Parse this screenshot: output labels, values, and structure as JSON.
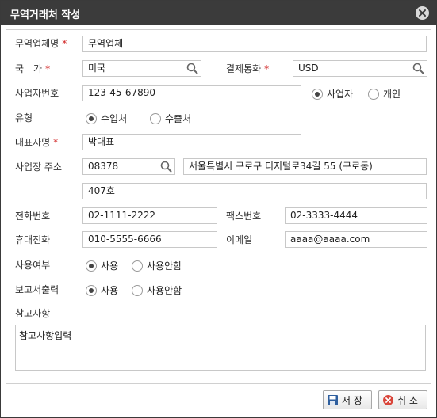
{
  "window": {
    "title": "무역거래처 작성"
  },
  "form": {
    "company_name": {
      "label": "무역업체명",
      "required": true,
      "value": "무역업체"
    },
    "country": {
      "label": "국　가",
      "required": true,
      "value": "미국"
    },
    "currency": {
      "label": "결제통화",
      "required": true,
      "value": "USD"
    },
    "business_no": {
      "label": "사업자번호",
      "value": "123-45-67890"
    },
    "entity_type": {
      "options": [
        "사업자",
        "개인"
      ],
      "selected": "사업자"
    },
    "trade_type": {
      "label": "유형",
      "options": [
        "수입처",
        "수출처"
      ],
      "selected": "수입처"
    },
    "ceo_name": {
      "label": "대표자명",
      "required": true,
      "value": "박대표"
    },
    "address": {
      "label": "사업장 주소",
      "zip": "08378",
      "street": "서울특별시 구로구 디지털로34길 55 (구로동)",
      "detail": "407호"
    },
    "phone": {
      "label": "전화번호",
      "value": "02-1111-2222"
    },
    "fax": {
      "label": "팩스번호",
      "value": "02-3333-4444"
    },
    "mobile": {
      "label": "휴대전화",
      "value": "010-5555-6666"
    },
    "email": {
      "label": "이메일",
      "value": "aaaa@aaaa.com"
    },
    "use_status": {
      "label": "사용여부",
      "options": [
        "사용",
        "사용안함"
      ],
      "selected": "사용"
    },
    "report_output": {
      "label": "보고서출력",
      "options": [
        "사용",
        "사용안함"
      ],
      "selected": "사용"
    },
    "notes": {
      "label": "참고사항",
      "value": "참고사항입력"
    },
    "required_mark": "*"
  },
  "buttons": {
    "save": "저 장",
    "cancel": "취 소"
  },
  "colors": {
    "titlebar": "#3b3b3b",
    "required": "#d02020",
    "cancel_icon": "#d9453a",
    "save_icon": "#2f5f9e"
  },
  "icons": [
    "close-icon",
    "search-icon",
    "save-icon",
    "cancel-icon"
  ]
}
